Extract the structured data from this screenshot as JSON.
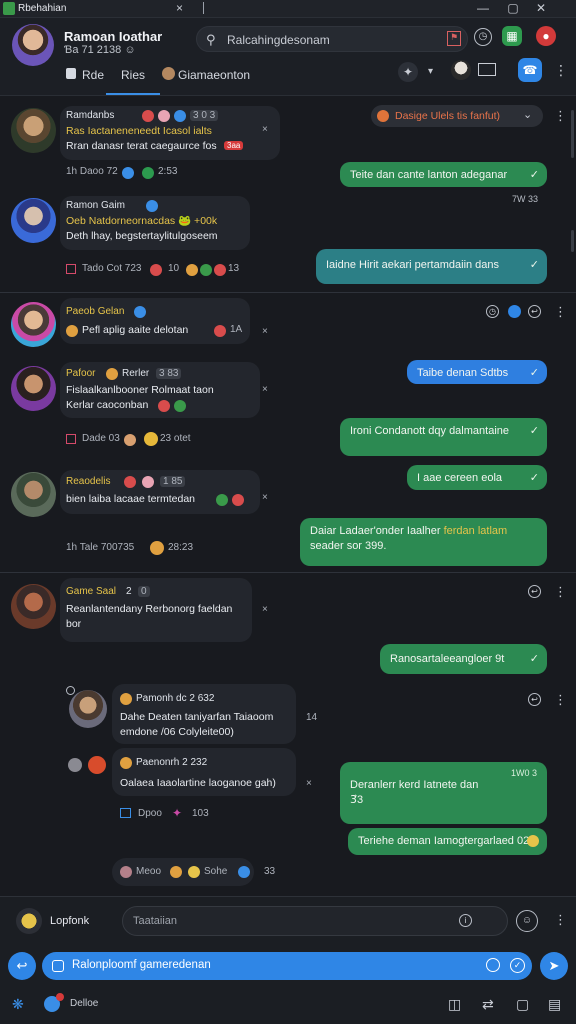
{
  "window": {
    "title": "Rbehahian",
    "close": "×",
    "controls": [
      "—",
      "▢",
      "✕"
    ]
  },
  "header": {
    "name": "Ramoan Ioathar",
    "subtitle": "Ɓa 71 2138 ☺",
    "search_value": "Ralcahingdesonam",
    "flag_glyph": "⚑",
    "tabs": [
      "Rde",
      "Ries",
      "Giamaeonton"
    ]
  },
  "conversations": [
    {
      "user": "Ramdanbs",
      "badge": "3 0 3",
      "line1": "Ras Iactaneneneedt Icasol ialts",
      "line2": "Rran danasr terat caegaurce fos",
      "tag": "3aa",
      "meta": "1h Daoo 72",
      "meta2": "2:53"
    },
    {
      "user": "Ramon Gaim",
      "line1": "Oeb Natdorneornacdas 🐸 +00k",
      "line2": "Deth lhay, begstertaylitulgoseem",
      "meta": "Tado Cot 723",
      "meta2": "10",
      "meta3": "13"
    },
    {
      "user": "Paeob Gelan",
      "line1": "Pefl aplig aaite delotan",
      "meta2": "1A"
    },
    {
      "user": "Pafoor",
      "user2": "Rerler",
      "badge": "3 83",
      "line1": "Fislaalkanlbooner Rolmaat taon",
      "line2": "Kerlar caoconban",
      "meta": "Dade 03",
      "meta2": "23 otet"
    },
    {
      "user": "Reaodelis",
      "badge": "1 85",
      "line1": "bien laiba lacaae termtedan",
      "meta": "1h Tale 700735",
      "meta2": "28:23"
    },
    {
      "user": "Game Saal",
      "user2": "2",
      "badge": "0",
      "line1": "Reanlantendany Rerbonorg faeldan",
      "line2": "bor"
    }
  ],
  "outgoing": [
    {
      "text": "Teite dan cante lanton adeganar",
      "ts": "7W 33"
    },
    {
      "text": "Iaidne Hirit aekari pertamdaiin dans"
    },
    {
      "text": "Taibe denan Sdtbs"
    },
    {
      "text": "Ironi Condanott dqy dalmantaine"
    },
    {
      "text": "I aae cereen eola"
    },
    {
      "text": "Daiar Ladaer'onder Iaalher",
      "hl": "ferdan latlam",
      "text2": "seader sor 399."
    },
    {
      "text": "Ranosartaleeangloer 9t"
    },
    {
      "text": "Deranlerr kerd Iatnete dan",
      "text2": "3⃗3",
      "ts": "1W0 3"
    },
    {
      "text": "Teriehe deman Iamogtergarlaed 02"
    }
  ],
  "thread": [
    {
      "user": "Pamonh dc 2 632",
      "line1": "Dahe Deaten taniyarfan Taiaoom",
      "line2": "emdone /06 Colyleite00)",
      "meta": "14"
    },
    {
      "user": "Paenonrh 2 232",
      "line1": "Oalaea Iaaolartine laoganoe gah)"
    },
    {
      "user": "Dpoo",
      "meta": "103"
    },
    {
      "user": "Meoo",
      "meta": "Sohe",
      "meta2": "33"
    }
  ],
  "pinned_banner": "Dasige Ulels tis fanfut)",
  "composer": {
    "label": "Lopfonk",
    "placeholder": "Taataiian",
    "reply_value": "Ralonploomf gameredenan"
  },
  "footer": {
    "user": "Delloe"
  },
  "colors": {
    "accent": "#2f86e6",
    "out_green": "#2c8a52",
    "out_teal": "#2c7f86",
    "bg": "#17191e"
  }
}
